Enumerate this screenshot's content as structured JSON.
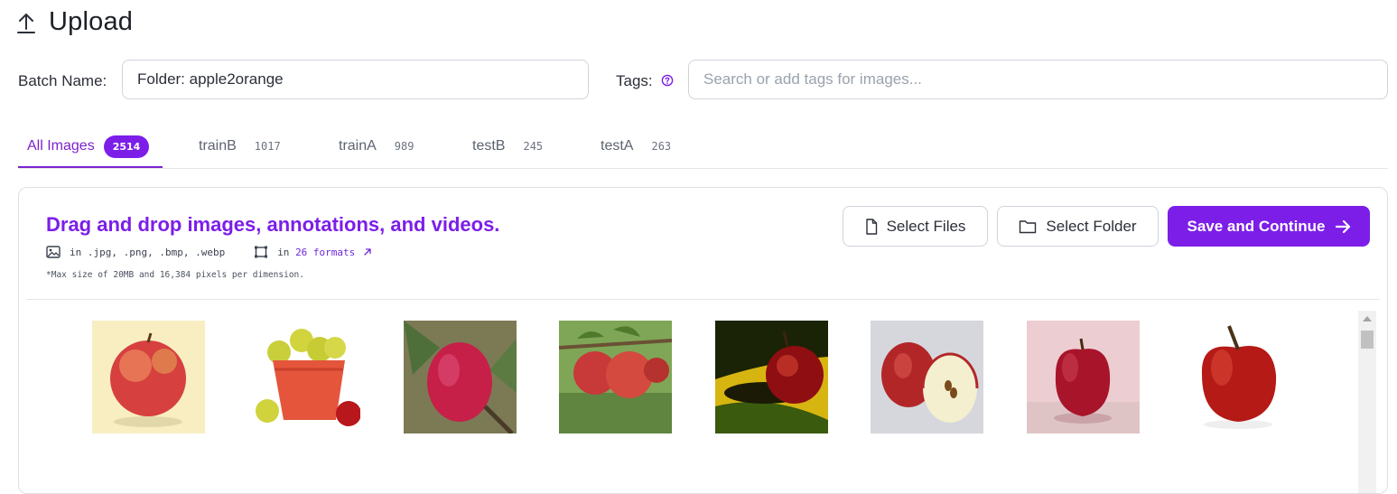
{
  "header": {
    "title": "Upload",
    "icon": "upload-icon"
  },
  "batch": {
    "label": "Batch Name:",
    "value": "Folder: apple2orange"
  },
  "tags": {
    "label": "Tags:",
    "placeholder": "Search or add tags for images...",
    "help_icon": "help-circle-icon"
  },
  "tabs": [
    {
      "name": "All Images",
      "count": "2514",
      "active": true
    },
    {
      "name": "trainB",
      "count": "1017"
    },
    {
      "name": "trainA",
      "count": "989"
    },
    {
      "name": "testB",
      "count": "245"
    },
    {
      "name": "testA",
      "count": "263"
    }
  ],
  "dropzone": {
    "title": "Drag and drop images, annotations, and videos.",
    "image_formats": "in .jpg, .png, .bmp, .webp",
    "annotation_formats_prefix": "in",
    "annotation_formats_link": "26 formats",
    "max_size": "*Max size of 20MB and 16,384 pixels per dimension.",
    "select_files": "Select Files",
    "select_folder": "Select Folder",
    "save_continue": "Save and Continue"
  },
  "colors": {
    "accent": "#7c1ee8",
    "border": "#cfd3da"
  },
  "thumbnails": [
    "apple-on-cream",
    "basket-of-yellow-apples",
    "apple-on-branch",
    "apples-on-tree",
    "apple-on-yellow",
    "apple-with-half",
    "apple-on-pink",
    "apple-on-white"
  ]
}
